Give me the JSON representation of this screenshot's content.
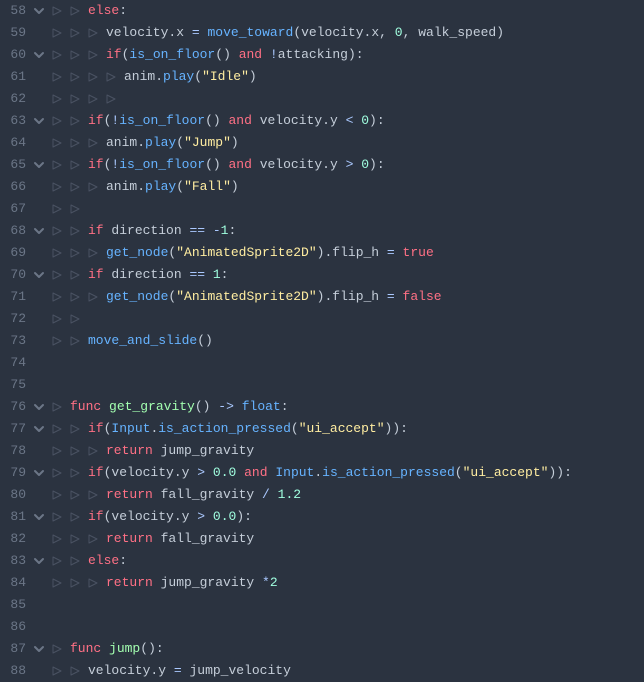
{
  "first_line": 58,
  "lines": [
    {
      "n": 58,
      "fold": true,
      "indents": 2,
      "tokens": [
        [
          "kw",
          "else"
        ],
        [
          "punc",
          ":"
        ]
      ]
    },
    {
      "n": 59,
      "fold": false,
      "indents": 3,
      "tokens": [
        [
          "id",
          "velocity"
        ],
        [
          "punc",
          "."
        ],
        [
          "id",
          "x"
        ],
        [
          "id",
          " "
        ],
        [
          "op",
          "="
        ],
        [
          "id",
          " "
        ],
        [
          "fn",
          "move_toward"
        ],
        [
          "punc",
          "("
        ],
        [
          "id",
          "velocity"
        ],
        [
          "punc",
          "."
        ],
        [
          "id",
          "x"
        ],
        [
          "punc",
          ","
        ],
        [
          "id",
          " "
        ],
        [
          "num",
          "0"
        ],
        [
          "punc",
          ","
        ],
        [
          "id",
          " walk_speed"
        ],
        [
          "punc",
          ")"
        ]
      ]
    },
    {
      "n": 60,
      "fold": true,
      "indents": 3,
      "tokens": [
        [
          "kw",
          "if"
        ],
        [
          "punc",
          "("
        ],
        [
          "fn",
          "is_on_floor"
        ],
        [
          "punc",
          "("
        ],
        [
          "punc",
          ")"
        ],
        [
          "id",
          " "
        ],
        [
          "kw",
          "and"
        ],
        [
          "id",
          " "
        ],
        [
          "op",
          "!"
        ],
        [
          "id",
          "attacking"
        ],
        [
          "punc",
          ")"
        ],
        [
          "punc",
          ":"
        ]
      ]
    },
    {
      "n": 61,
      "fold": false,
      "indents": 4,
      "tokens": [
        [
          "id",
          "anim"
        ],
        [
          "punc",
          "."
        ],
        [
          "fn",
          "play"
        ],
        [
          "punc",
          "("
        ],
        [
          "str",
          "\"Idle\""
        ],
        [
          "punc",
          ")"
        ]
      ]
    },
    {
      "n": 62,
      "fold": false,
      "indents": 4,
      "tokens": []
    },
    {
      "n": 63,
      "fold": true,
      "indents": 2,
      "tokens": [
        [
          "kw",
          "if"
        ],
        [
          "punc",
          "("
        ],
        [
          "op",
          "!"
        ],
        [
          "fn",
          "is_on_floor"
        ],
        [
          "punc",
          "("
        ],
        [
          "punc",
          ")"
        ],
        [
          "id",
          " "
        ],
        [
          "kw",
          "and"
        ],
        [
          "id",
          " velocity"
        ],
        [
          "punc",
          "."
        ],
        [
          "id",
          "y"
        ],
        [
          "id",
          " "
        ],
        [
          "op",
          "<"
        ],
        [
          "id",
          " "
        ],
        [
          "num",
          "0"
        ],
        [
          "punc",
          ")"
        ],
        [
          "punc",
          ":"
        ]
      ]
    },
    {
      "n": 64,
      "fold": false,
      "indents": 3,
      "tokens": [
        [
          "id",
          "anim"
        ],
        [
          "punc",
          "."
        ],
        [
          "fn",
          "play"
        ],
        [
          "punc",
          "("
        ],
        [
          "str",
          "\"Jump\""
        ],
        [
          "punc",
          ")"
        ]
      ]
    },
    {
      "n": 65,
      "fold": true,
      "indents": 2,
      "tokens": [
        [
          "kw",
          "if"
        ],
        [
          "punc",
          "("
        ],
        [
          "op",
          "!"
        ],
        [
          "fn",
          "is_on_floor"
        ],
        [
          "punc",
          "("
        ],
        [
          "punc",
          ")"
        ],
        [
          "id",
          " "
        ],
        [
          "kw",
          "and"
        ],
        [
          "id",
          " velocity"
        ],
        [
          "punc",
          "."
        ],
        [
          "id",
          "y"
        ],
        [
          "id",
          " "
        ],
        [
          "op",
          ">"
        ],
        [
          "id",
          " "
        ],
        [
          "num",
          "0"
        ],
        [
          "punc",
          ")"
        ],
        [
          "punc",
          ":"
        ]
      ]
    },
    {
      "n": 66,
      "fold": false,
      "indents": 3,
      "tokens": [
        [
          "id",
          "anim"
        ],
        [
          "punc",
          "."
        ],
        [
          "fn",
          "play"
        ],
        [
          "punc",
          "("
        ],
        [
          "str",
          "\"Fall\""
        ],
        [
          "punc",
          ")"
        ]
      ]
    },
    {
      "n": 67,
      "fold": false,
      "indents": 2,
      "tokens": []
    },
    {
      "n": 68,
      "fold": true,
      "indents": 2,
      "tokens": [
        [
          "kw",
          "if"
        ],
        [
          "id",
          " direction "
        ],
        [
          "op",
          "=="
        ],
        [
          "id",
          " "
        ],
        [
          "op",
          "-"
        ],
        [
          "num",
          "1"
        ],
        [
          "punc",
          ":"
        ]
      ]
    },
    {
      "n": 69,
      "fold": false,
      "indents": 3,
      "tokens": [
        [
          "fn",
          "get_node"
        ],
        [
          "punc",
          "("
        ],
        [
          "str",
          "\"AnimatedSprite2D\""
        ],
        [
          "punc",
          ")"
        ],
        [
          "punc",
          "."
        ],
        [
          "id",
          "flip_h"
        ],
        [
          "id",
          " "
        ],
        [
          "op",
          "="
        ],
        [
          "id",
          " "
        ],
        [
          "const",
          "true"
        ]
      ]
    },
    {
      "n": 70,
      "fold": true,
      "indents": 2,
      "tokens": [
        [
          "kw",
          "if"
        ],
        [
          "id",
          " direction "
        ],
        [
          "op",
          "=="
        ],
        [
          "id",
          " "
        ],
        [
          "num",
          "1"
        ],
        [
          "punc",
          ":"
        ]
      ]
    },
    {
      "n": 71,
      "fold": false,
      "indents": 3,
      "tokens": [
        [
          "fn",
          "get_node"
        ],
        [
          "punc",
          "("
        ],
        [
          "str",
          "\"AnimatedSprite2D\""
        ],
        [
          "punc",
          ")"
        ],
        [
          "punc",
          "."
        ],
        [
          "id",
          "flip_h"
        ],
        [
          "id",
          " "
        ],
        [
          "op",
          "="
        ],
        [
          "id",
          " "
        ],
        [
          "const",
          "false"
        ]
      ]
    },
    {
      "n": 72,
      "fold": false,
      "indents": 2,
      "tokens": []
    },
    {
      "n": 73,
      "fold": false,
      "indents": 2,
      "tokens": [
        [
          "fn",
          "move_and_slide"
        ],
        [
          "punc",
          "("
        ],
        [
          "punc",
          ")"
        ]
      ]
    },
    {
      "n": 74,
      "fold": false,
      "indents": 0,
      "tokens": []
    },
    {
      "n": 75,
      "fold": false,
      "indents": 0,
      "tokens": []
    },
    {
      "n": 76,
      "fold": true,
      "indents": 1,
      "tokens": [
        [
          "kw",
          "func"
        ],
        [
          "id",
          " "
        ],
        [
          "fname",
          "get_gravity"
        ],
        [
          "punc",
          "("
        ],
        [
          "punc",
          ")"
        ],
        [
          "id",
          " "
        ],
        [
          "op",
          "->"
        ],
        [
          "id",
          " "
        ],
        [
          "fn",
          "float"
        ],
        [
          "punc",
          ":"
        ]
      ]
    },
    {
      "n": 77,
      "fold": true,
      "indents": 2,
      "tokens": [
        [
          "kw",
          "if"
        ],
        [
          "punc",
          "("
        ],
        [
          "fn",
          "Input"
        ],
        [
          "punc",
          "."
        ],
        [
          "fn",
          "is_action_pressed"
        ],
        [
          "punc",
          "("
        ],
        [
          "str",
          "\"ui_accept\""
        ],
        [
          "punc",
          ")"
        ],
        [
          "punc",
          ")"
        ],
        [
          "punc",
          ":"
        ]
      ]
    },
    {
      "n": 78,
      "fold": false,
      "indents": 3,
      "tokens": [
        [
          "kw",
          "return"
        ],
        [
          "id",
          " jump_gravity"
        ]
      ]
    },
    {
      "n": 79,
      "fold": true,
      "indents": 2,
      "tokens": [
        [
          "kw",
          "if"
        ],
        [
          "punc",
          "("
        ],
        [
          "id",
          "velocity"
        ],
        [
          "punc",
          "."
        ],
        [
          "id",
          "y"
        ],
        [
          "id",
          " "
        ],
        [
          "op",
          ">"
        ],
        [
          "id",
          " "
        ],
        [
          "num",
          "0.0"
        ],
        [
          "id",
          " "
        ],
        [
          "kw",
          "and"
        ],
        [
          "id",
          " "
        ],
        [
          "fn",
          "Input"
        ],
        [
          "punc",
          "."
        ],
        [
          "fn",
          "is_action_pressed"
        ],
        [
          "punc",
          "("
        ],
        [
          "str",
          "\"ui_accept\""
        ],
        [
          "punc",
          ")"
        ],
        [
          "punc",
          ")"
        ],
        [
          "punc",
          ":"
        ]
      ]
    },
    {
      "n": 80,
      "fold": false,
      "indents": 3,
      "tokens": [
        [
          "kw",
          "return"
        ],
        [
          "id",
          " fall_gravity "
        ],
        [
          "op",
          "/"
        ],
        [
          "id",
          " "
        ],
        [
          "num",
          "1.2"
        ]
      ]
    },
    {
      "n": 81,
      "fold": true,
      "indents": 2,
      "tokens": [
        [
          "kw",
          "if"
        ],
        [
          "punc",
          "("
        ],
        [
          "id",
          "velocity"
        ],
        [
          "punc",
          "."
        ],
        [
          "id",
          "y"
        ],
        [
          "id",
          " "
        ],
        [
          "op",
          ">"
        ],
        [
          "id",
          " "
        ],
        [
          "num",
          "0.0"
        ],
        [
          "punc",
          ")"
        ],
        [
          "punc",
          ":"
        ]
      ]
    },
    {
      "n": 82,
      "fold": false,
      "indents": 3,
      "tokens": [
        [
          "kw",
          "return"
        ],
        [
          "id",
          " fall_gravity"
        ]
      ]
    },
    {
      "n": 83,
      "fold": true,
      "indents": 2,
      "tokens": [
        [
          "kw",
          "else"
        ],
        [
          "punc",
          ":"
        ]
      ]
    },
    {
      "n": 84,
      "fold": false,
      "indents": 3,
      "tokens": [
        [
          "kw",
          "return"
        ],
        [
          "id",
          " jump_gravity "
        ],
        [
          "op",
          "*"
        ],
        [
          "num",
          "2"
        ]
      ]
    },
    {
      "n": 85,
      "fold": false,
      "indents": 0,
      "tokens": []
    },
    {
      "n": 86,
      "fold": false,
      "indents": 0,
      "tokens": []
    },
    {
      "n": 87,
      "fold": true,
      "indents": 1,
      "tokens": [
        [
          "kw",
          "func"
        ],
        [
          "id",
          " "
        ],
        [
          "fname",
          "jump"
        ],
        [
          "punc",
          "("
        ],
        [
          "punc",
          ")"
        ],
        [
          "punc",
          ":"
        ]
      ]
    },
    {
      "n": 88,
      "fold": false,
      "indents": 2,
      "tokens": [
        [
          "id",
          "velocity"
        ],
        [
          "punc",
          "."
        ],
        [
          "id",
          "y"
        ],
        [
          "id",
          " "
        ],
        [
          "op",
          "="
        ],
        [
          "id",
          " jump_velocity"
        ]
      ]
    }
  ]
}
